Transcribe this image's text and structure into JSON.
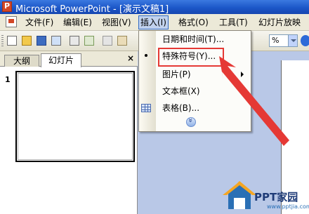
{
  "window": {
    "title": "Microsoft PowerPoint - [演示文稿1]"
  },
  "menubar": {
    "items": [
      {
        "label": "文件(F)"
      },
      {
        "label": "编辑(E)"
      },
      {
        "label": "视图(V)"
      },
      {
        "label": "插入(I)"
      },
      {
        "label": "格式(O)"
      },
      {
        "label": "工具(T)"
      },
      {
        "label": "幻灯片放映"
      }
    ]
  },
  "toolbar": {
    "zoom_value": "%"
  },
  "left_pane": {
    "tabs": [
      {
        "label": "大纲"
      },
      {
        "label": "幻灯片"
      }
    ],
    "close_glyph": "×",
    "slide_number": "1"
  },
  "insert_menu": {
    "items": [
      {
        "label": "日期和时间(T)..."
      },
      {
        "label": "特殊符号(Y)..."
      },
      {
        "label": "图片(P)"
      },
      {
        "label": "文本框(X)"
      },
      {
        "label": "表格(B)..."
      }
    ],
    "highlighted_item": "特殊符号(Y)...",
    "icons": [
      "chart-dot-icon",
      "table-icon",
      "expand-icon"
    ]
  },
  "annotation": {
    "highlight_color": "#e53935",
    "arrow_color": "#e53935"
  },
  "watermark": {
    "text": "PPT家园",
    "url": "www.pptjia.com"
  }
}
